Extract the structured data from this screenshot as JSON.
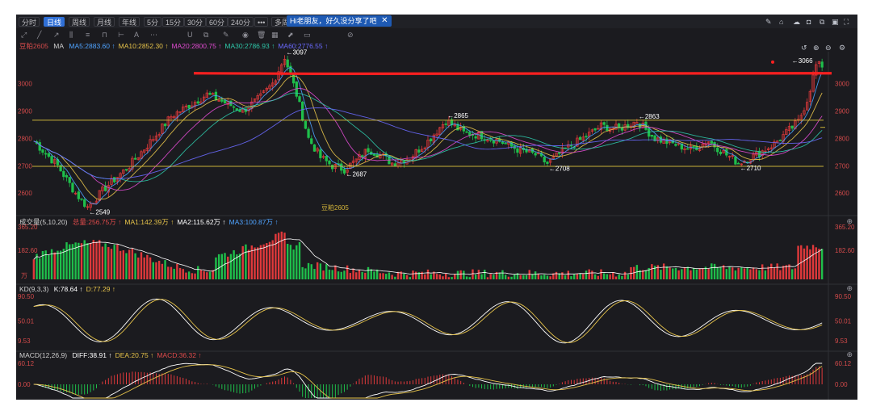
{
  "toolbar": {
    "periods": [
      "分时",
      "日线",
      "周线",
      "月线",
      "年线",
      "5分",
      "15分",
      "30分",
      "60分",
      "240分",
      "•••",
      "多周"
    ],
    "active": "日线",
    "greeting": "Hi老朋友，好久没分享了吧",
    "greeting_close": "✕"
  },
  "symbol": "豆粕2605",
  "symbol_label": "豆粕2605",
  "ma_legend": {
    "prefix": "MA",
    "items": [
      {
        "text": "MA5:2883.60",
        "color": "#4fa3ff"
      },
      {
        "text": "MA10:2852.30",
        "color": "#e6c34a"
      },
      {
        "text": "MA20:2800.75",
        "color": "#e04bd0"
      },
      {
        "text": "MA30:2786.93",
        "color": "#2ec6a8"
      },
      {
        "text": "MA60:2776.55",
        "color": "#6a6aff"
      }
    ]
  },
  "volume_legend": {
    "title": "成交量(5,10,20)",
    "items": [
      {
        "text": "总量:256.75万",
        "color": "#e04b4b"
      },
      {
        "text": "MA1:142.39万",
        "color": "#e6c34a"
      },
      {
        "text": "MA2:115.62万",
        "color": "#ffffff"
      },
      {
        "text": "MA3:100.87万",
        "color": "#4fa3ff"
      }
    ]
  },
  "kd_legend": {
    "title": "KD(9,3,3)",
    "items": [
      {
        "text": "K:78.64",
        "color": "#ffffff"
      },
      {
        "text": "D:77.29",
        "color": "#e6c34a"
      }
    ]
  },
  "macd_legend": {
    "title": "MACD(12,26,9)",
    "items": [
      {
        "text": "DIFF:38.91",
        "color": "#ffffff"
      },
      {
        "text": "DEA:20.75",
        "color": "#e6c34a"
      },
      {
        "text": "MACD:36.32",
        "color": "#e04b4b"
      }
    ]
  },
  "chart_data": {
    "type": "candlestick",
    "symbol": "豆粕2605",
    "price_axis": {
      "ticks": [
        "3000",
        "2900",
        "2800",
        "2700",
        "2600"
      ],
      "ylim": [
        2530,
        3110
      ]
    },
    "annotations": [
      "3097",
      "2549",
      "2687",
      "2865",
      "2708",
      "2863",
      "2710",
      "3066"
    ],
    "price_path": [
      [
        0,
        2790
      ],
      [
        8,
        2700
      ],
      [
        14,
        2600
      ],
      [
        18,
        2549
      ],
      [
        24,
        2620
      ],
      [
        32,
        2700
      ],
      [
        40,
        2800
      ],
      [
        46,
        2880
      ],
      [
        52,
        2920
      ],
      [
        58,
        2960
      ],
      [
        64,
        2930
      ],
      [
        70,
        2900
      ],
      [
        76,
        2950
      ],
      [
        80,
        3000
      ],
      [
        84,
        3097
      ],
      [
        88,
        2960
      ],
      [
        92,
        2800
      ],
      [
        96,
        2730
      ],
      [
        100,
        2700
      ],
      [
        104,
        2687
      ],
      [
        108,
        2720
      ],
      [
        112,
        2760
      ],
      [
        116,
        2740
      ],
      [
        120,
        2710
      ],
      [
        126,
        2730
      ],
      [
        132,
        2790
      ],
      [
        138,
        2865
      ],
      [
        144,
        2820
      ],
      [
        150,
        2810
      ],
      [
        156,
        2790
      ],
      [
        162,
        2760
      ],
      [
        168,
        2740
      ],
      [
        172,
        2708
      ],
      [
        178,
        2760
      ],
      [
        184,
        2800
      ],
      [
        190,
        2845
      ],
      [
        196,
        2835
      ],
      [
        202,
        2863
      ],
      [
        208,
        2800
      ],
      [
        214,
        2780
      ],
      [
        220,
        2760
      ],
      [
        226,
        2790
      ],
      [
        232,
        2740
      ],
      [
        236,
        2710
      ],
      [
        242,
        2740
      ],
      [
        248,
        2780
      ],
      [
        252,
        2820
      ],
      [
        256,
        2860
      ],
      [
        259,
        2940
      ],
      [
        262,
        3066
      ]
    ],
    "horizontal_lines": [
      {
        "value": 3040,
        "color": "#ff2020"
      },
      {
        "value": 2866,
        "color": "#c9b23a"
      },
      {
        "value": 2698,
        "color": "#c9b23a"
      }
    ],
    "volume_axis": {
      "ticks": [
        "365.20",
        "182.60"
      ],
      "unit": "万"
    },
    "kd_axis": {
      "ticks": [
        "90.50",
        "50.01",
        "9.53"
      ]
    },
    "macd_axis": {
      "ticks": [
        "60.12",
        "0.00"
      ]
    }
  }
}
